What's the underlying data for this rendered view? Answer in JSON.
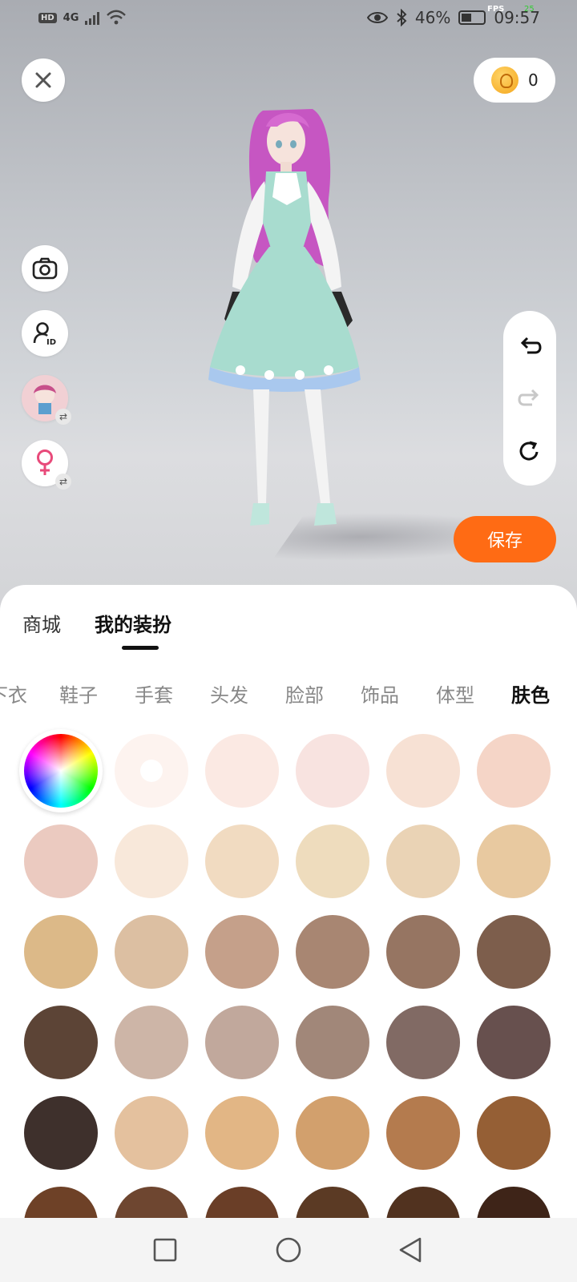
{
  "status_bar": {
    "hd": "HD",
    "network": "4G",
    "battery": "46%",
    "time": "09:57",
    "fps_label": "FPS",
    "fps_value": "25"
  },
  "coins": {
    "count": "0"
  },
  "actions": {
    "save_label": "保存"
  },
  "panel": {
    "tabs": [
      {
        "label": "商城",
        "active": false
      },
      {
        "label": "我的装扮",
        "active": true
      }
    ],
    "categories": [
      {
        "label": "下衣",
        "active": false
      },
      {
        "label": "鞋子",
        "active": false
      },
      {
        "label": "手套",
        "active": false
      },
      {
        "label": "头发",
        "active": false
      },
      {
        "label": "脸部",
        "active": false
      },
      {
        "label": "饰品",
        "active": false
      },
      {
        "label": "体型",
        "active": false
      },
      {
        "label": "肤色",
        "active": true
      }
    ],
    "swatches": [
      "#fdf3ef",
      "#fbe9e3",
      "#f8e3e0",
      "#f7e1d4",
      "#f5d5c7",
      "#ebcac0",
      "#f8e8da",
      "#f1dbc1",
      "#eedcbd",
      "#ead3b5",
      "#e8c9a0",
      "#dcb988",
      "#dcbfa2",
      "#c5a08a",
      "#a88672",
      "#967562",
      "#7d5e4c",
      "#5c4436",
      "#cdb5a7",
      "#c1a89c",
      "#a18779",
      "#816a64",
      "#67504e",
      "#3e302c",
      "#e4c19e",
      "#e2b685",
      "#d2a06d",
      "#b47b4e",
      "#955f35",
      "#6e4127",
      "#6e4630",
      "#6a3e27",
      "#5b3a24",
      "#51321f",
      "#3e2418"
    ],
    "selected_index": 0
  }
}
